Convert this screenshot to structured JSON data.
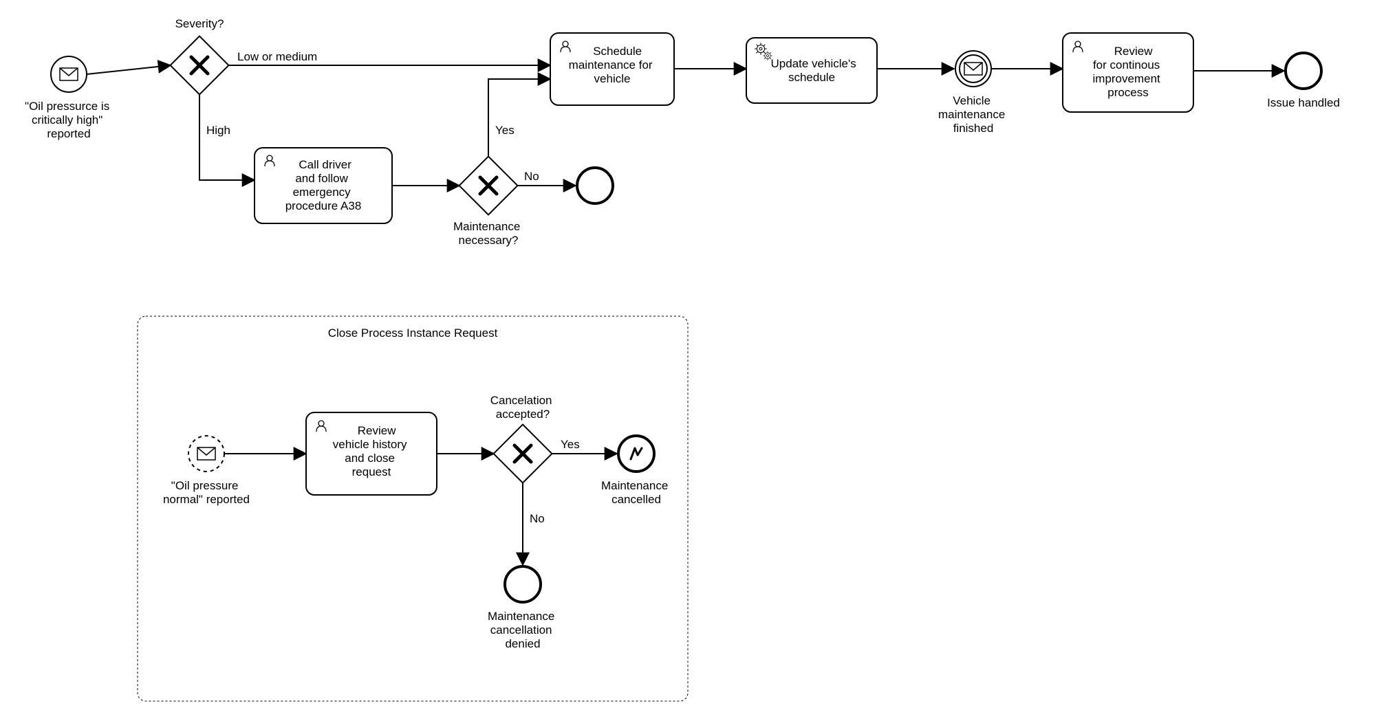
{
  "diagram": {
    "events": {
      "start": {
        "label": "\"Oil pressurce is critically high\" reported"
      },
      "maint_done": {
        "label": "Vehicle maintenance finished"
      },
      "end_main": {
        "label": "Issue handled"
      },
      "end_no_maint": {
        "label": ""
      },
      "sub_start": {
        "label": "\"Oil pressure normal\" reported"
      },
      "sub_cancel": {
        "label": "Maintenance cancelled"
      },
      "sub_denied": {
        "label": "Maintenance cancellation denied"
      }
    },
    "gateways": {
      "severity": {
        "label": "Severity?"
      },
      "maint_req": {
        "label": "Maintenance necessary?"
      },
      "cancel_ok": {
        "label": "Cancelation accepted?"
      }
    },
    "tasks": {
      "call_driver": {
        "label": "Call driver and follow emergency procedure A38"
      },
      "schedule": {
        "label": "Schedule maintenance for vehicle"
      },
      "update_sched": {
        "label": "Update vehicle's schedule"
      },
      "review_ci": {
        "label": "Review for continous improvement process"
      },
      "review_close": {
        "label": "Review vehicle history and close request"
      }
    },
    "flows": {
      "low_or_medium": "Low or medium",
      "high": "High",
      "yes": "Yes",
      "no": "No"
    },
    "subprocess": {
      "title": "Close Process Instance Request"
    }
  }
}
